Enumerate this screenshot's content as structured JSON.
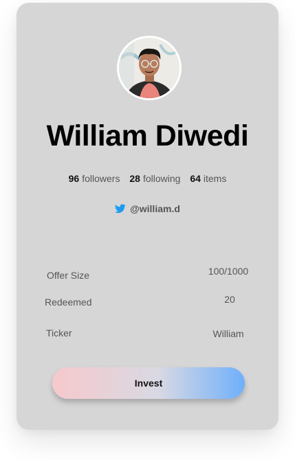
{
  "profile": {
    "name": "William Diwedi",
    "handle": "@william.d"
  },
  "stats": [
    {
      "value": "96",
      "label": "followers"
    },
    {
      "value": "28",
      "label": "following"
    },
    {
      "value": "64",
      "label": "items"
    }
  ],
  "details": {
    "offer_size_label": "Offer Size",
    "offer_size_value": "100/1000",
    "redeemed_label": "Redeemed",
    "redeemed_value": "20",
    "ticker_label": "Ticker",
    "ticker_value": "William"
  },
  "actions": {
    "invest_label": "Invest"
  },
  "colors": {
    "card_background": "#d6d6d6",
    "twitter_blue": "#1d9bf0",
    "button_gradient_start": "#f6c9cc",
    "button_gradient_end": "#6fb0fb"
  },
  "icons": {
    "social": "twitter-icon"
  }
}
